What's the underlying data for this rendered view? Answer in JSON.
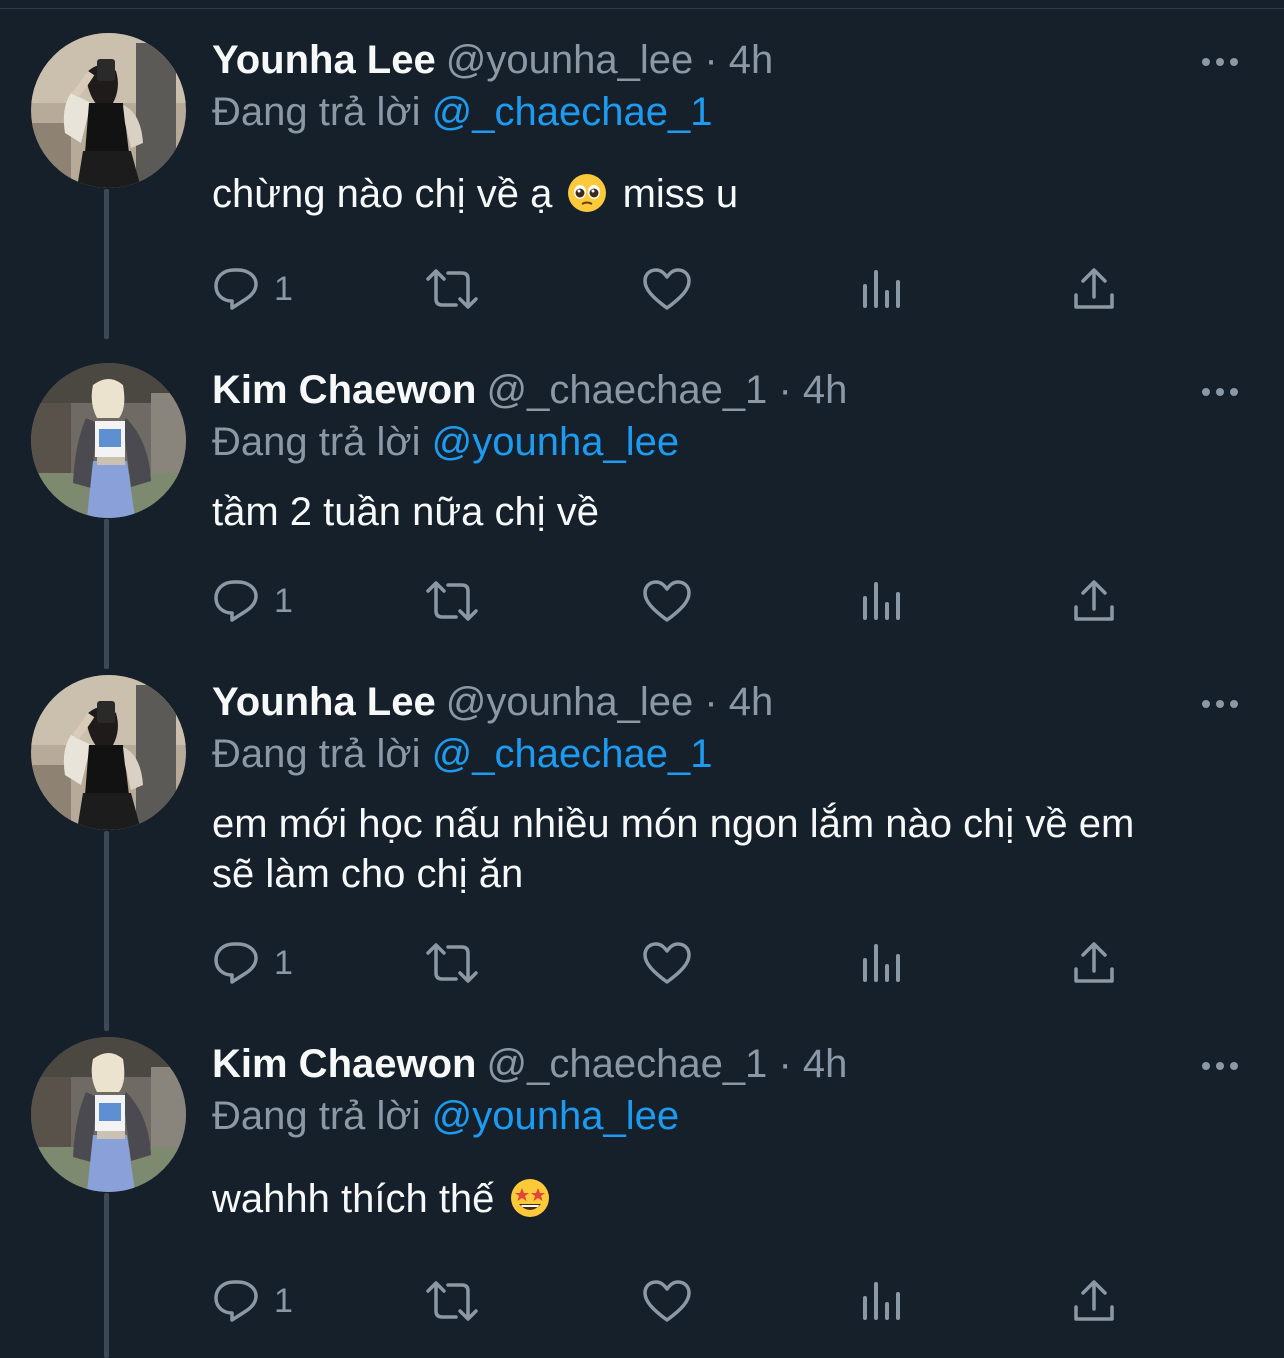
{
  "tweets": [
    {
      "name": "Younha Lee",
      "handle": "@younha_lee",
      "time": "4h",
      "reply_prefix": "Đang trả lời",
      "reply_to": "@_chaechae_1",
      "text_before_emoji": "chừng nào chị về ạ",
      "emoji": "pleading-face",
      "text_after_emoji": "miss u",
      "reply_count": "1",
      "avatar": "younha-avatar"
    },
    {
      "name": "Kim Chaewon",
      "handle": "@_chaechae_1",
      "time": "4h",
      "reply_prefix": "Đang trả lời",
      "reply_to": "@younha_lee",
      "text": "tầm 2 tuần nữa chị về",
      "reply_count": "1",
      "avatar": "chaewon-avatar"
    },
    {
      "name": "Younha Lee",
      "handle": "@younha_lee",
      "time": "4h",
      "reply_prefix": "Đang trả lời",
      "reply_to": "@_chaechae_1",
      "text_line1": "em mới học nấu nhiều món ngon lắm nào chị về em",
      "text_line2": "sẽ làm cho chị ăn",
      "reply_count": "1",
      "avatar": "younha-avatar"
    },
    {
      "name": "Kim Chaewon",
      "handle": "@_chaechae_1",
      "time": "4h",
      "reply_prefix": "Đang trả lời",
      "reply_to": "@younha_lee",
      "text": "wahhh thích thế",
      "emoji": "star-struck",
      "reply_count": "1",
      "avatar": "chaewon-avatar"
    }
  ],
  "separator": "·",
  "icons": [
    "reply-icon",
    "retweet-icon",
    "like-icon",
    "analytics-icon",
    "share-icon",
    "more-icon"
  ],
  "colors": {
    "background": "#15202b",
    "text": "#f7f9f9",
    "muted": "#8b98a5",
    "mention": "#1d9bf0",
    "thread_line": "#3d4a56"
  }
}
